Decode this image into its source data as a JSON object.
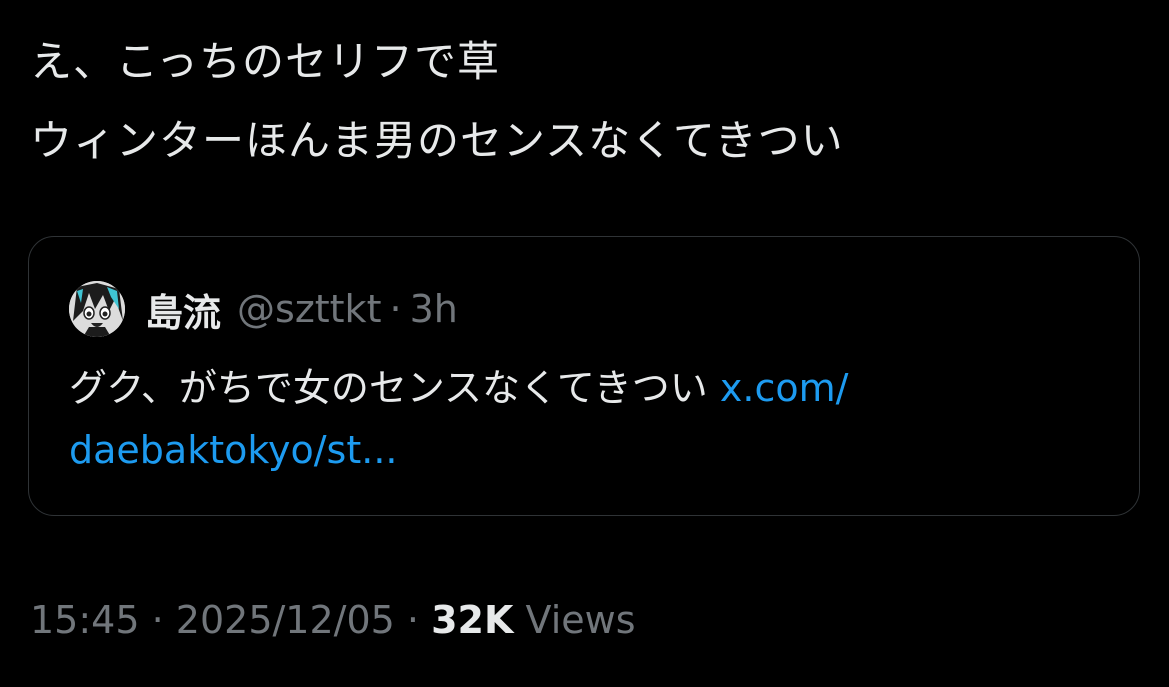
{
  "post": {
    "lines": [
      "え、こっちのセリフで草",
      "ウィンターほんま男のセンスなくてきつい"
    ]
  },
  "quote": {
    "author_name": "島流",
    "author_handle": "@szttkt",
    "separator": "·",
    "age": "3h",
    "text": "グク、がちで女のセンスなくてきつい",
    "link_line1": "x.com/",
    "link_line2": "daebaktokyo/st..."
  },
  "meta": {
    "time": "15:45",
    "separator": "·",
    "date": "2025/12/05",
    "views_count": "32K",
    "views_label": "Views"
  },
  "colors": {
    "background": "#000000",
    "text": "#e7e9ea",
    "muted": "#71767b",
    "link": "#1d9bf0",
    "border": "#2f3336"
  },
  "icons": {
    "avatar": "anime-avatar-icon"
  }
}
